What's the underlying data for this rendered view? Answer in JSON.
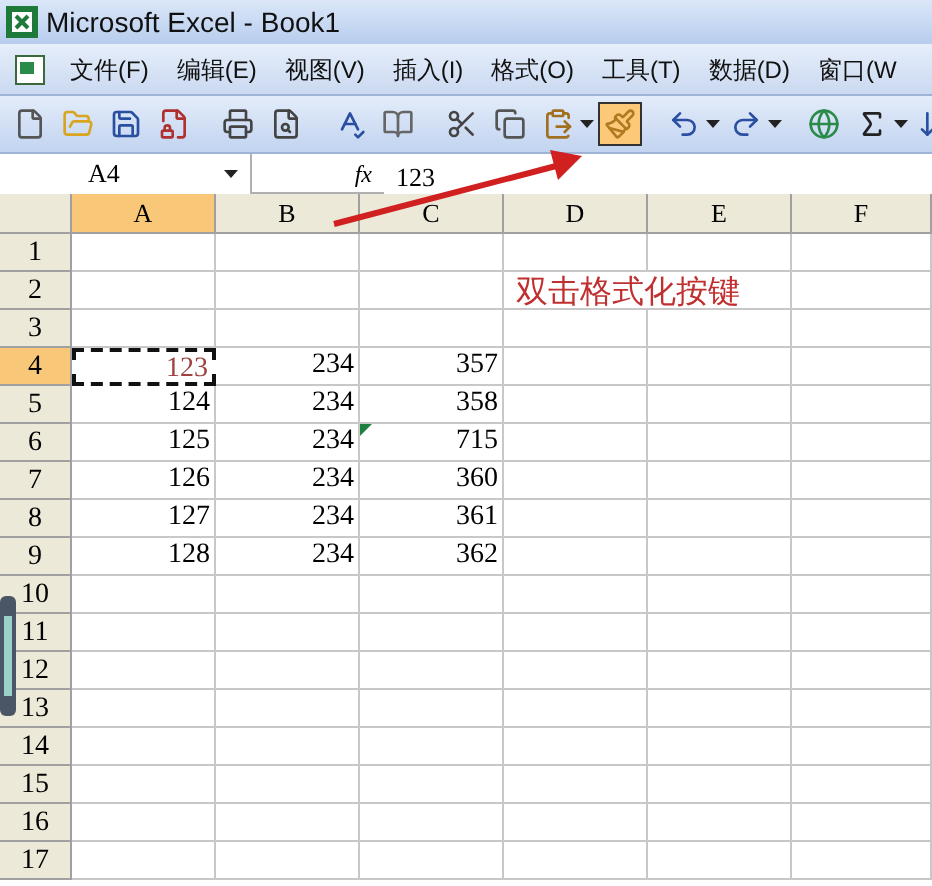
{
  "window": {
    "title": "Microsoft Excel - Book1"
  },
  "menu": [
    "文件(F)",
    "编辑(E)",
    "视图(V)",
    "插入(I)",
    "格式(O)",
    "工具(T)",
    "数据(D)",
    "窗口(W"
  ],
  "toolbar": [
    {
      "kind": "new",
      "highlighted": false
    },
    {
      "kind": "open",
      "highlighted": false
    },
    {
      "kind": "save",
      "highlighted": false
    },
    {
      "kind": "permission",
      "highlighted": false
    },
    {
      "kind": "sep"
    },
    {
      "kind": "print",
      "highlighted": false
    },
    {
      "kind": "preview",
      "highlighted": false
    },
    {
      "kind": "sep"
    },
    {
      "kind": "spelling",
      "highlighted": false
    },
    {
      "kind": "research",
      "highlighted": false
    },
    {
      "kind": "sep"
    },
    {
      "kind": "cut",
      "highlighted": false
    },
    {
      "kind": "copy",
      "highlighted": false
    },
    {
      "kind": "paste",
      "highlighted": false
    },
    {
      "kind": "painter",
      "highlighted": true
    },
    {
      "kind": "sep"
    },
    {
      "kind": "undo",
      "highlighted": false
    },
    {
      "kind": "redo",
      "highlighted": false
    },
    {
      "kind": "sep"
    },
    {
      "kind": "link",
      "highlighted": false
    },
    {
      "kind": "sum",
      "highlighted": false
    },
    {
      "kind": "sort",
      "highlighted": false
    }
  ],
  "formula_bar": {
    "name_box": "A4",
    "fx": "fx",
    "value": "123"
  },
  "columns": [
    {
      "label": "A",
      "selected": true
    },
    {
      "label": "B",
      "selected": false
    },
    {
      "label": "C",
      "selected": false
    },
    {
      "label": "D",
      "selected": false
    },
    {
      "label": "E",
      "selected": false
    },
    {
      "label": "F",
      "selected": false
    }
  ],
  "rows": [
    {
      "header": "1",
      "selected": false
    },
    {
      "header": "2",
      "selected": false,
      "note": "双击格式化按键"
    },
    {
      "header": "3",
      "selected": false
    },
    {
      "header": "4",
      "selected": true,
      "cells": [
        {
          "text": "123",
          "selected": true,
          "flag": false
        },
        {
          "text": "234",
          "selected": false,
          "flag": false
        },
        {
          "text": "357",
          "selected": false,
          "flag": false
        }
      ]
    },
    {
      "header": "5",
      "selected": false,
      "cells": [
        {
          "text": "124",
          "selected": false,
          "flag": false
        },
        {
          "text": "234",
          "selected": false,
          "flag": false
        },
        {
          "text": "358",
          "selected": false,
          "flag": false
        }
      ]
    },
    {
      "header": "6",
      "selected": false,
      "cells": [
        {
          "text": "125",
          "selected": false,
          "flag": false
        },
        {
          "text": "234",
          "selected": false,
          "flag": false
        },
        {
          "text": "715",
          "selected": false,
          "flag": true
        }
      ]
    },
    {
      "header": "7",
      "selected": false,
      "cells": [
        {
          "text": "126",
          "selected": false,
          "flag": false
        },
        {
          "text": "234",
          "selected": false,
          "flag": false
        },
        {
          "text": "360",
          "selected": false,
          "flag": false
        }
      ]
    },
    {
      "header": "8",
      "selected": false,
      "cells": [
        {
          "text": "127",
          "selected": false,
          "flag": false
        },
        {
          "text": "234",
          "selected": false,
          "flag": false
        },
        {
          "text": "361",
          "selected": false,
          "flag": false
        }
      ]
    },
    {
      "header": "9",
      "selected": false,
      "cells": [
        {
          "text": "128",
          "selected": false,
          "flag": false
        },
        {
          "text": "234",
          "selected": false,
          "flag": false
        },
        {
          "text": "362",
          "selected": false,
          "flag": false
        }
      ]
    },
    {
      "header": "10",
      "selected": false
    },
    {
      "header": "11",
      "selected": false
    },
    {
      "header": "12",
      "selected": false
    },
    {
      "header": "13",
      "selected": false
    },
    {
      "header": "14",
      "selected": false
    },
    {
      "header": "15",
      "selected": false
    },
    {
      "header": "16",
      "selected": false
    },
    {
      "header": "17",
      "selected": false
    }
  ]
}
